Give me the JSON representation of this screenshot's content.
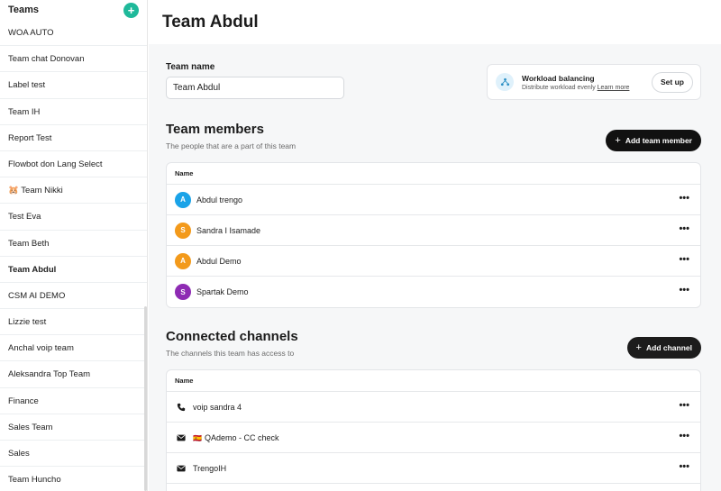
{
  "sidebar": {
    "title": "Teams",
    "add_icon": "plus-icon",
    "items": [
      {
        "label": "WOA AUTO"
      },
      {
        "label": "Team chat Donovan"
      },
      {
        "label": "Label test"
      },
      {
        "label": "Team IH"
      },
      {
        "label": "Report Test"
      },
      {
        "label": "Flowbot don Lang Select"
      },
      {
        "label": "🐹 Team Nikki"
      },
      {
        "label": "Test Eva"
      },
      {
        "label": "Team Beth"
      },
      {
        "label": "Team Abdul",
        "active": true
      },
      {
        "label": "CSM AI DEMO"
      },
      {
        "label": "Lizzie test"
      },
      {
        "label": "Anchal voip team"
      },
      {
        "label": "Aleksandra Top Team"
      },
      {
        "label": "Finance"
      },
      {
        "label": "Sales Team"
      },
      {
        "label": "Sales"
      },
      {
        "label": "Team Huncho"
      }
    ]
  },
  "header": {
    "title": "Team Abdul"
  },
  "team_name": {
    "label": "Team name",
    "value": "Team Abdul"
  },
  "workload": {
    "title": "Workload balancing",
    "description": "Distribute workload evenly",
    "link": "Learn more",
    "button": "Set up"
  },
  "members": {
    "title": "Team members",
    "subtitle": "The people that are a part of this team",
    "add_button": "Add team member",
    "column": "Name",
    "rows": [
      {
        "initial": "A",
        "name": "Abdul trengo",
        "color": "#1aa3e8"
      },
      {
        "initial": "S",
        "name": "Sandra I Isamade",
        "color": "#f39a1b"
      },
      {
        "initial": "A",
        "name": "Abdul Demo",
        "color": "#f39a1b"
      },
      {
        "initial": "S",
        "name": "Spartak Demo",
        "color": "#8e2bb3"
      }
    ]
  },
  "channels": {
    "title": "Connected channels",
    "subtitle": "The channels this team has access to",
    "add_button": "Add channel",
    "column": "Name",
    "rows": [
      {
        "icon": "phone-icon",
        "flag": "",
        "name": "voip sandra 4"
      },
      {
        "icon": "mail-icon",
        "flag": "🇪🇸",
        "name": "QAdemo - CC check"
      },
      {
        "icon": "mail-icon",
        "flag": "",
        "name": "TrengoIH"
      }
    ]
  },
  "colors": {
    "accent": "#1fb99a",
    "dark_button": "#111111"
  }
}
